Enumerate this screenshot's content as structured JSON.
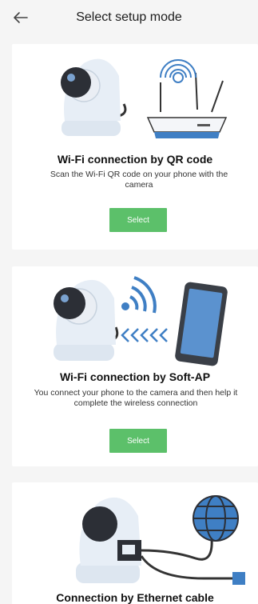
{
  "header": {
    "title": "Select setup mode",
    "back_icon": "arrow-left-icon"
  },
  "modes": [
    {
      "title": "Wi-Fi connection by QR code",
      "description": "Scan the Wi-Fi QR code on your phone with the camera",
      "button_label": "Select"
    },
    {
      "title": "Wi-Fi connection by Soft-AP",
      "description": "You connect your phone to the camera and then help it complete the wireless connection",
      "button_label": "Select"
    },
    {
      "title": "Connection by Ethernet cable"
    }
  ],
  "colors": {
    "accent": "#5cc06a",
    "background": "#f5f5f5",
    "card": "#ffffff",
    "illustration_blue": "#3f7fc4"
  }
}
